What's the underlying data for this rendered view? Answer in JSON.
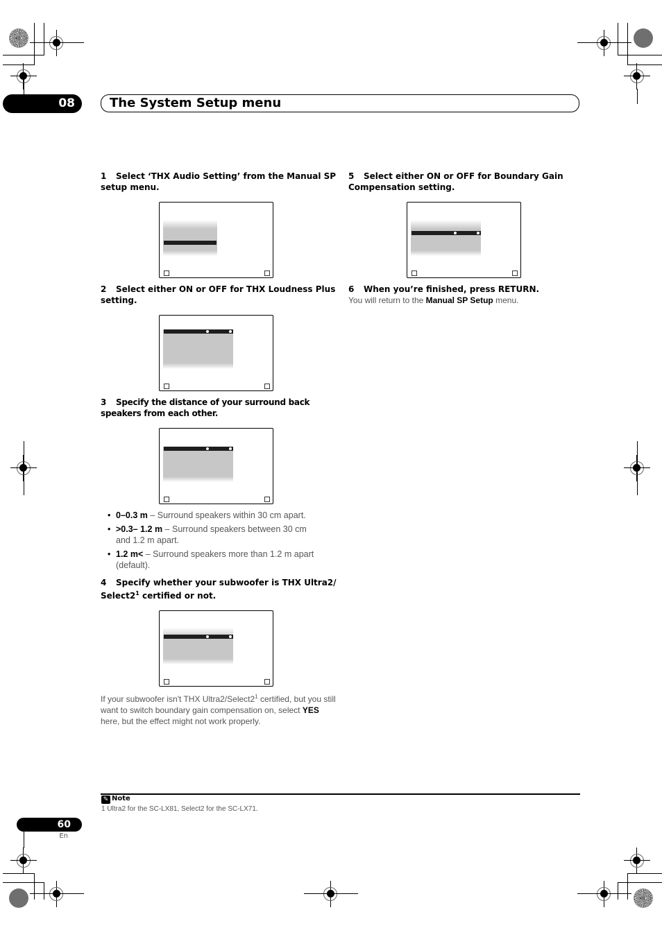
{
  "header": {
    "chapter_number": "08",
    "chapter_title": "The System Setup menu"
  },
  "steps": [
    {
      "number": "1",
      "text": "Select ‘THX Audio Setting’ from the Manual SP setup menu."
    },
    {
      "number": "2",
      "text": "Select either ON or OFF for THX Loudness Plus setting."
    },
    {
      "number": "3",
      "text": "Specify the distance of your surround back speakers from each other."
    },
    {
      "number": "4",
      "text_before_sup": "Specify whether your subwoofer is THX Ultra2/ Select2",
      "sup": "1",
      "text_after_sup": " certified or not."
    },
    {
      "number": "5",
      "text": "Select either ON or OFF for Boundary Gain Compensation setting."
    },
    {
      "number": "6",
      "text": "When you’re finished, press RETURN."
    }
  ],
  "bullets": [
    {
      "term": "0–0.3 m",
      "desc": " – Surround speakers within 30 cm apart."
    },
    {
      "term": ">0.3– 1.2 m",
      "desc": " – Surround speakers between 30 cm and 1.2 m apart."
    },
    {
      "term": "1.2 m<",
      "desc": " – Surround speakers more than 1.2 m apart (default)."
    }
  ],
  "subwoofer_note": {
    "part1": "If your subwoofer isn't THX Ultra2/Select2",
    "sup": "1",
    "part2": " certified, but you still want to switch boundary gain compensation on, select ",
    "bold": "YES",
    "part3": " here, but the effect might not work properly."
  },
  "return_note": {
    "part1": "You will return to the ",
    "bold": "Manual SP Setup",
    "part2": " menu."
  },
  "osd_screens": [
    {
      "id": "thx-audio-setting",
      "icons": [
        "return-icon",
        "exit-icon"
      ]
    },
    {
      "id": "thx-loudness-plus",
      "icons": [
        "return-icon",
        "exit-icon"
      ]
    },
    {
      "id": "sb-speaker-distance",
      "icons": [
        "return-icon",
        "exit-icon"
      ]
    },
    {
      "id": "subwoofer-certified",
      "icons": [
        "return-icon",
        "exit-icon"
      ]
    },
    {
      "id": "boundary-gain-compensation",
      "icons": [
        "return-icon",
        "exit-icon"
      ]
    }
  ],
  "footer": {
    "note_label": "Note",
    "footnote": "1 Ultra2 for the SC-LX81, Select2 for the SC-LX71.",
    "page_number": "60",
    "language": "En"
  }
}
